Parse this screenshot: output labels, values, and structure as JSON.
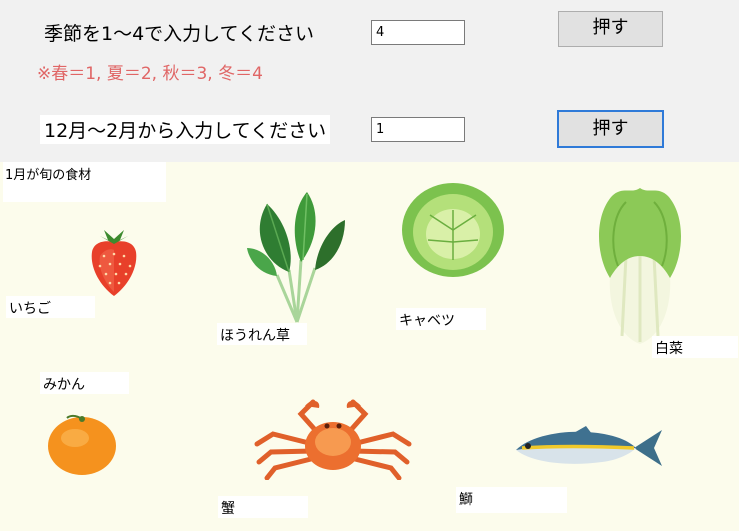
{
  "season_prompt": "季節を1～4で入力してください",
  "season_hint": "※春＝1, 夏＝2, 秋＝3, 冬＝4",
  "season_input_value": "4",
  "season_button_label": "押す",
  "month_prompt": "12月～2月から入力してください",
  "month_input_value": "1",
  "month_button_label": "押す",
  "panel_title": "1月が旬の食材",
  "foods": [
    {
      "label": "いちご",
      "icon": "strawberry-icon"
    },
    {
      "label": "ほうれん草",
      "icon": "spinach-icon"
    },
    {
      "label": "キャベツ",
      "icon": "cabbage-icon"
    },
    {
      "label": "白菜",
      "icon": "napa-cabbage-icon"
    },
    {
      "label": "みかん",
      "icon": "mandarin-orange-icon"
    },
    {
      "label": "蟹",
      "icon": "crab-icon"
    },
    {
      "label": "鰤",
      "icon": "yellowtail-fish-icon"
    }
  ],
  "colors": {
    "hint": "#e06666",
    "panel_bg": "#fcfcec",
    "focus_border": "#2f7ad8"
  }
}
